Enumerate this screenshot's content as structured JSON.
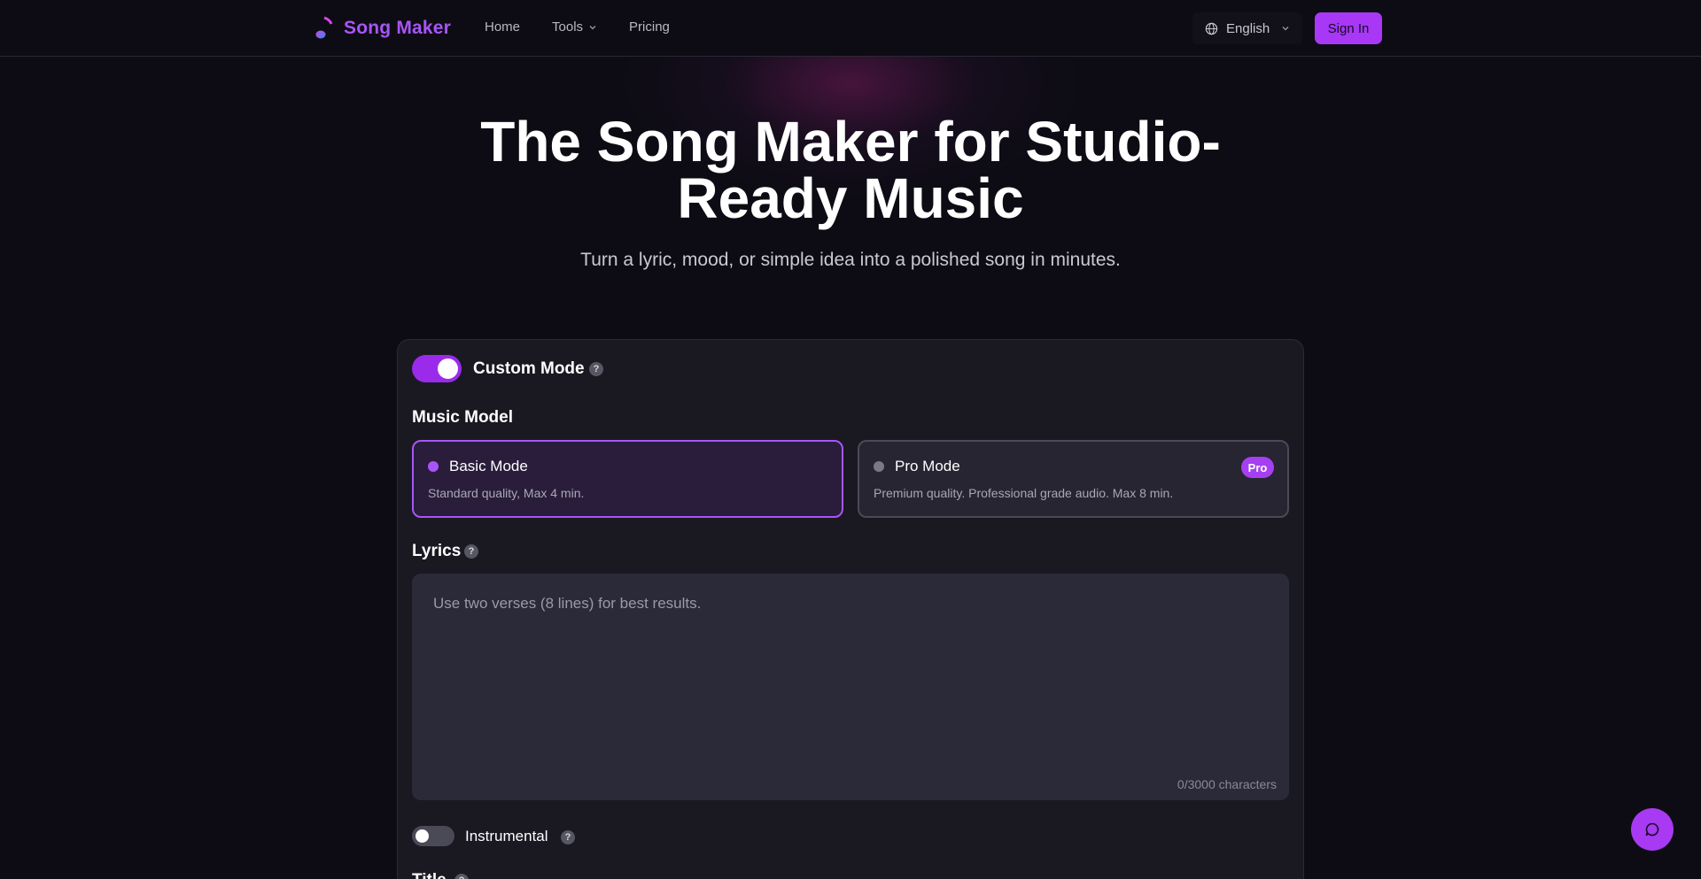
{
  "nav": {
    "brand": "Song Maker",
    "links": [
      {
        "label": "Home"
      },
      {
        "label": "Tools"
      },
      {
        "label": "Pricing"
      }
    ],
    "language": "English",
    "sign_in": "Sign In"
  },
  "hero": {
    "title": "The Song Maker for Studio-Ready Music",
    "subtitle": "Turn a lyric, mood, or simple idea into a polished song in minutes."
  },
  "form": {
    "custom_mode": {
      "label": "Custom Mode",
      "enabled": true
    },
    "music_model_label": "Music Model",
    "modes": [
      {
        "name": "Basic Mode",
        "desc": "Standard quality, Max 4 min.",
        "selected": true
      },
      {
        "name": "Pro Mode",
        "desc": "Premium quality. Professional grade audio. Max 8 min.",
        "badge": "Pro",
        "selected": false
      }
    ],
    "lyrics": {
      "label": "Lyrics",
      "placeholder": "Use two verses (8 lines) for best results.",
      "value": "",
      "count": "0/3000 characters"
    },
    "instrumental": {
      "label": "Instrumental",
      "enabled": false
    },
    "title_label": "Title"
  },
  "colors": {
    "accent": "#a855f7",
    "background": "#0d0c14",
    "card": "#1a1922"
  }
}
